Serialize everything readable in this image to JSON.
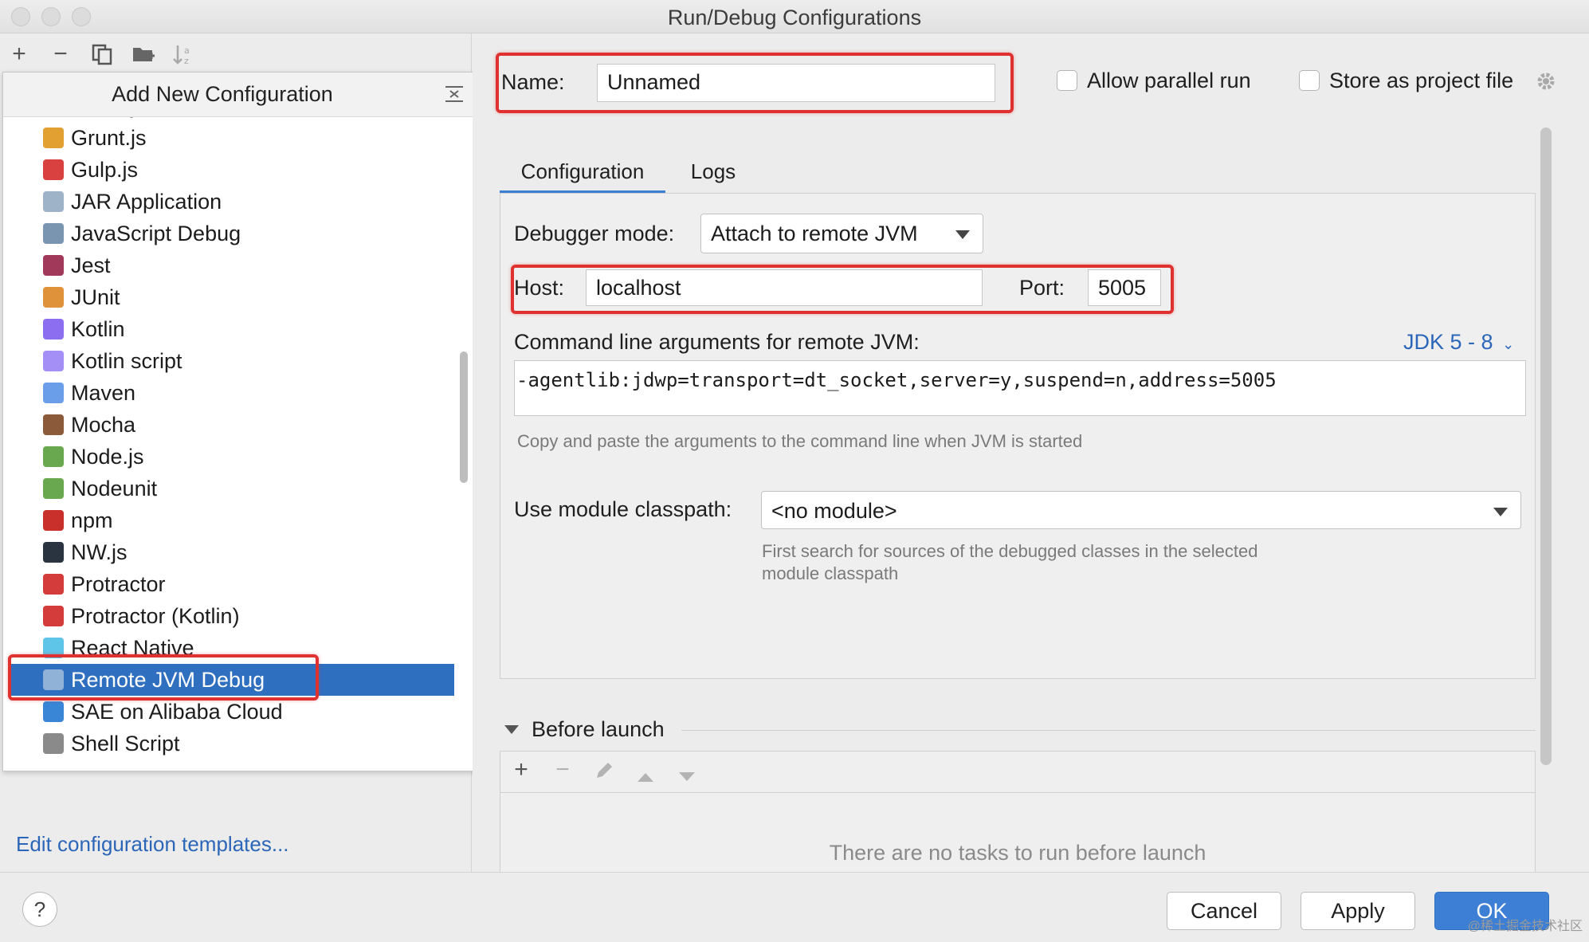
{
  "window": {
    "title": "Run/Debug Configurations"
  },
  "toolbar": {
    "add_icon": "plus-icon",
    "remove_icon": "minus-icon",
    "copy_icon": "copy-icon",
    "folder_icon": "new-folder-icon",
    "sort_icon": "sort-icon"
  },
  "popup": {
    "title": "Add New Configuration",
    "items": [
      {
        "label": "Groovy",
        "icon": "groovy-icon",
        "color": "#6fbf4c"
      },
      {
        "label": "Grunt.js",
        "icon": "grunt-icon",
        "color": "#e2a032"
      },
      {
        "label": "Gulp.js",
        "icon": "gulp-icon",
        "color": "#d94040"
      },
      {
        "label": "JAR Application",
        "icon": "jar-icon",
        "color": "#9fb3c8"
      },
      {
        "label": "JavaScript Debug",
        "icon": "javascript-debug-icon",
        "color": "#7a95b0"
      },
      {
        "label": "Jest",
        "icon": "jest-icon",
        "color": "#a1395b"
      },
      {
        "label": "JUnit",
        "icon": "junit-icon",
        "color": "#e0923a"
      },
      {
        "label": "Kotlin",
        "icon": "kotlin-icon",
        "color": "#8b6ff0"
      },
      {
        "label": "Kotlin script",
        "icon": "kotlin-script-icon",
        "color": "#a38ff5"
      },
      {
        "label": "Maven",
        "icon": "maven-icon",
        "color": "#6b9ee8"
      },
      {
        "label": "Mocha",
        "icon": "mocha-icon",
        "color": "#8a5a3b"
      },
      {
        "label": "Node.js",
        "icon": "nodejs-icon",
        "color": "#6aa84f"
      },
      {
        "label": "Nodeunit",
        "icon": "nodeunit-icon",
        "color": "#6aa84f"
      },
      {
        "label": "npm",
        "icon": "npm-icon",
        "color": "#c9302c"
      },
      {
        "label": "NW.js",
        "icon": "nwjs-icon",
        "color": "#2a3440"
      },
      {
        "label": "Protractor",
        "icon": "protractor-icon",
        "color": "#d43b3b"
      },
      {
        "label": "Protractor (Kotlin)",
        "icon": "protractor-kotlin-icon",
        "color": "#d43b3b"
      },
      {
        "label": "React Native",
        "icon": "react-native-icon",
        "color": "#5fc5e8"
      },
      {
        "label": "Remote JVM Debug",
        "icon": "remote-jvm-debug-icon",
        "color": "#8fb2d6"
      },
      {
        "label": "SAE on Alibaba Cloud",
        "icon": "alibaba-cloud-icon",
        "color": "#3a86d6"
      },
      {
        "label": "Shell Script",
        "icon": "shell-script-icon",
        "color": "#8a8a8a"
      }
    ],
    "selected_index": 18
  },
  "footer_left": {
    "edit_templates": "Edit configuration templates..."
  },
  "form": {
    "name_label": "Name:",
    "name_value": "Unnamed",
    "allow_parallel": "Allow parallel run",
    "store_as_project": "Store as project file",
    "tabs": [
      "Configuration",
      "Logs"
    ],
    "debugger_mode_label": "Debugger mode:",
    "debugger_mode_value": "Attach to remote JVM",
    "host_label": "Host:",
    "host_value": "localhost",
    "port_label": "Port:",
    "port_value": "5005",
    "cmd_label": "Command line arguments for remote JVM:",
    "jdk_link": "JDK 5 - 8",
    "cmd_value": "-agentlib:jdwp=transport=dt_socket,server=y,suspend=n,address=5005",
    "cmd_hint": "Copy and paste the arguments to the command line when JVM is started",
    "module_label": "Use module classpath:",
    "module_value": "<no module>",
    "module_hint_1": "First search for sources of the debugged classes in the selected",
    "module_hint_2": "module classpath",
    "before_launch": "Before launch",
    "before_launch_empty": "There are no tasks to run before launch"
  },
  "buttons": {
    "help": "?",
    "cancel": "Cancel",
    "apply": "Apply",
    "ok": "OK"
  },
  "watermark": "@稀土掘金技术社区",
  "colors": {
    "accent": "#3d7fd4",
    "selection": "#2f6fbf",
    "highlight": "#e03131",
    "link": "#2b66b8"
  }
}
